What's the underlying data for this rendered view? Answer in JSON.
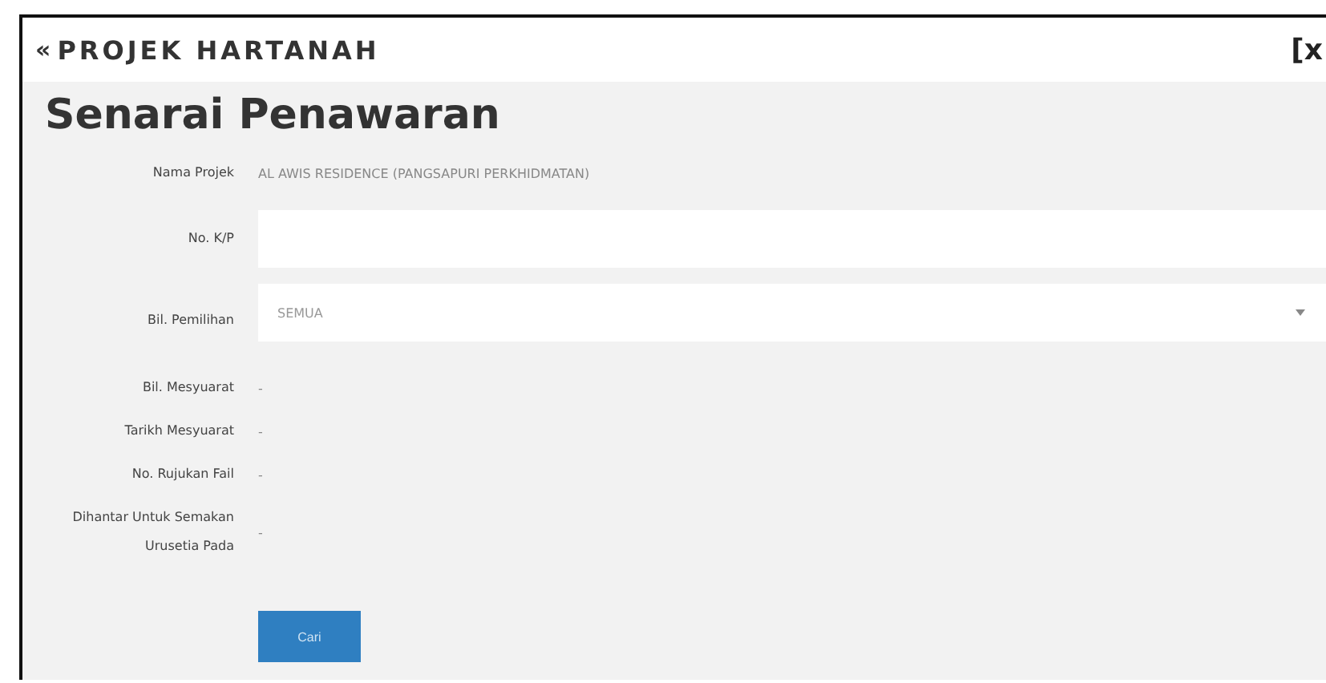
{
  "header": {
    "back_icon": "«",
    "title": "PROJEK HARTANAH",
    "close": "[x"
  },
  "page_title": "Senarai Penawaran",
  "fields": [
    {
      "kind": "static",
      "label": "Nama Projek",
      "value": "AL AWIS RESIDENCE (PANGSAPURI PERKHIDMATAN)"
    },
    {
      "kind": "input",
      "label": "No. K/P"
    },
    {
      "kind": "select",
      "label": "Bil. Pemilihan",
      "value": "SEMUA"
    },
    {
      "kind": "static",
      "label": "Bil. Mesyuarat",
      "value": "-"
    },
    {
      "kind": "static",
      "label": "Tarikh Mesyuarat",
      "value": "-"
    },
    {
      "kind": "static",
      "label": "No. Rujukan Fail",
      "value": "-"
    },
    {
      "kind": "static",
      "label": "Dihantar Untuk Semakan Urusetia Pada",
      "value": "-"
    }
  ],
  "button": "Cari"
}
